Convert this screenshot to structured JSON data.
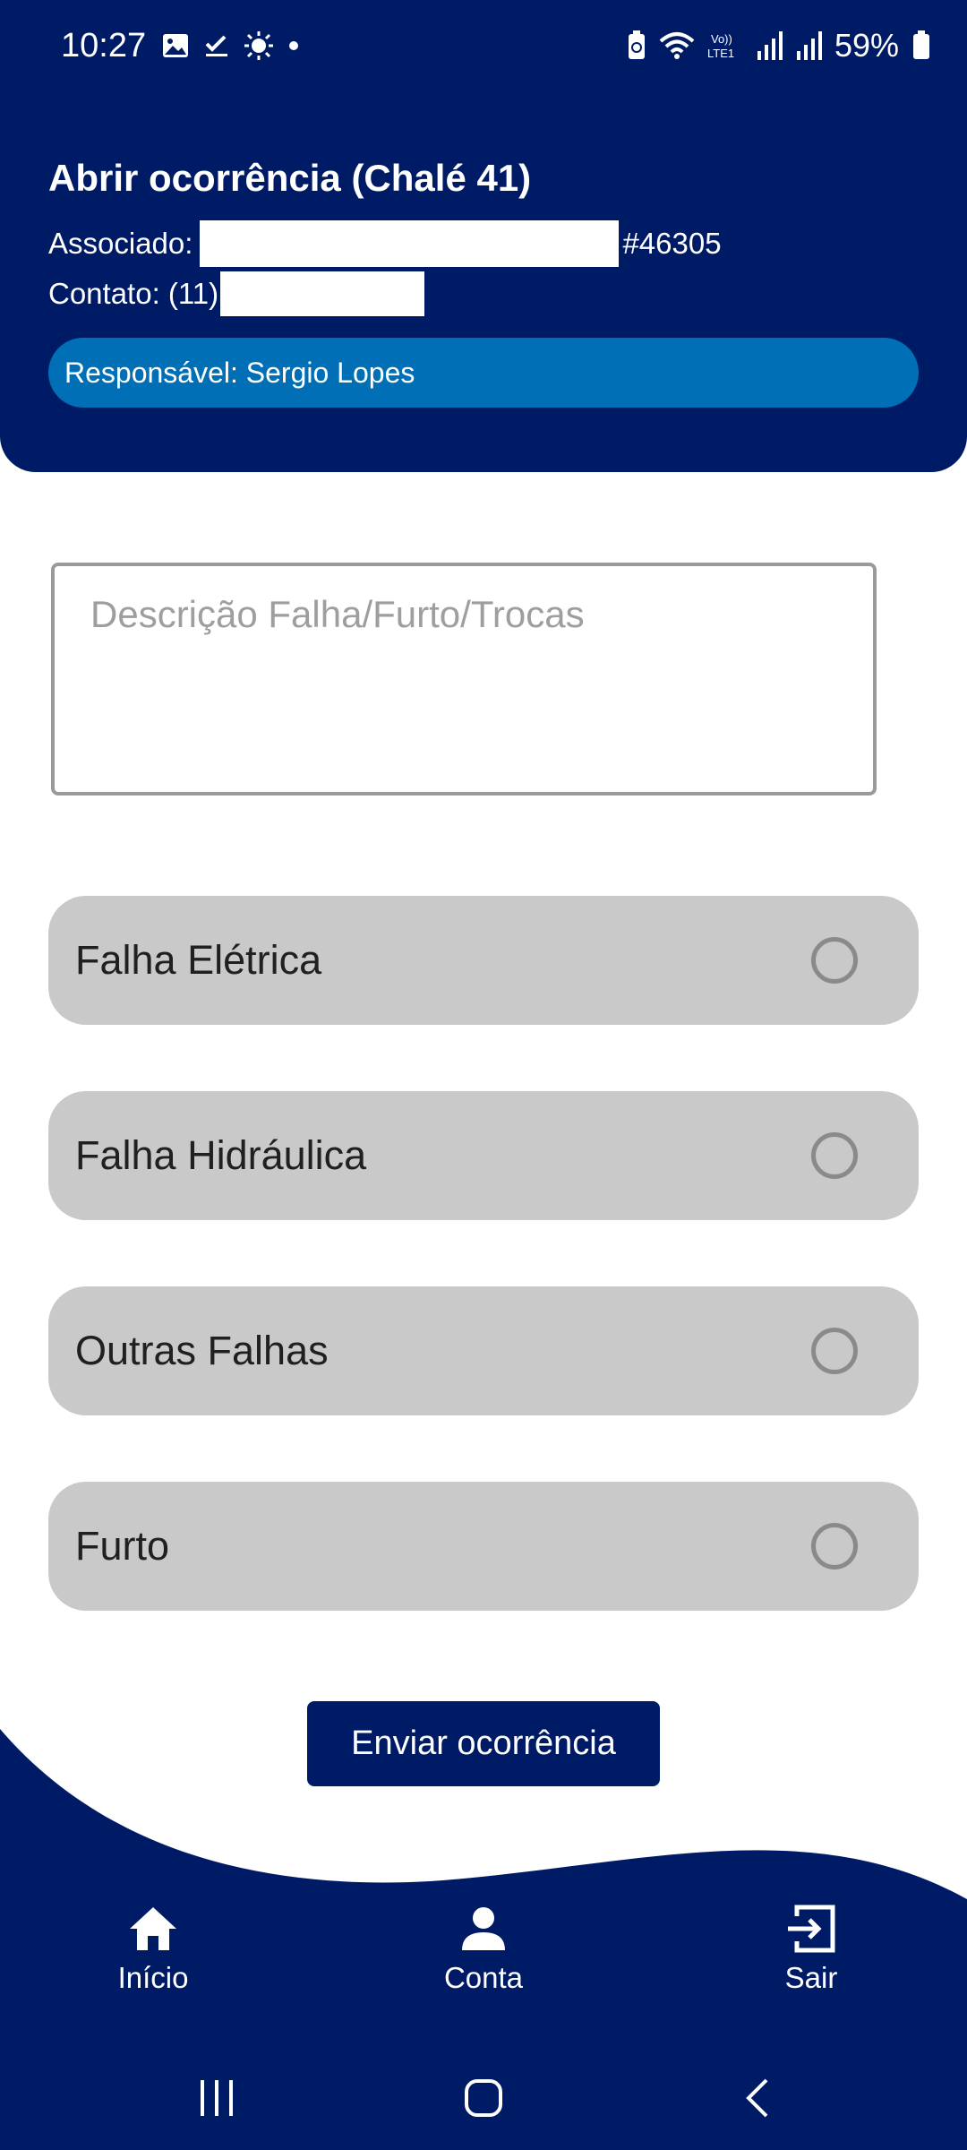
{
  "status_bar": {
    "time": "10:27",
    "battery": "59%",
    "left_icons": [
      "image-icon",
      "check-icon",
      "brightness-icon",
      "dot-icon"
    ],
    "right_icons": [
      "battery-saver-icon",
      "wifi-icon",
      "volte-icon",
      "signal-icon",
      "signal-icon",
      "battery-icon"
    ]
  },
  "header": {
    "title": "Abrir ocorrência (Chalé 41)",
    "associado_label": "Associado:",
    "associado_id": "#46305",
    "contato_label": "Contato: (11)",
    "responsavel": "Responsável: Sergio Lopes"
  },
  "form": {
    "description_placeholder": "Descrição Falha/Furto/Trocas",
    "description_value": "",
    "options": [
      {
        "label": "Falha Elétrica",
        "selected": false
      },
      {
        "label": "Falha Hidráulica",
        "selected": false
      },
      {
        "label": "Outras Falhas",
        "selected": false
      },
      {
        "label": "Furto",
        "selected": false
      }
    ],
    "submit_label": "Enviar ocorrência"
  },
  "bottom_nav": {
    "items": [
      {
        "label": "Início",
        "icon": "home-icon"
      },
      {
        "label": "Conta",
        "icon": "person-icon"
      },
      {
        "label": "Sair",
        "icon": "exit-icon"
      }
    ]
  },
  "system_nav": [
    "recents-icon",
    "home-circle-icon",
    "back-icon"
  ],
  "colors": {
    "primary": "#001b66",
    "accent": "#006fb6",
    "option_bg": "#c9c9c9",
    "radio_border": "#8a8a8a"
  }
}
